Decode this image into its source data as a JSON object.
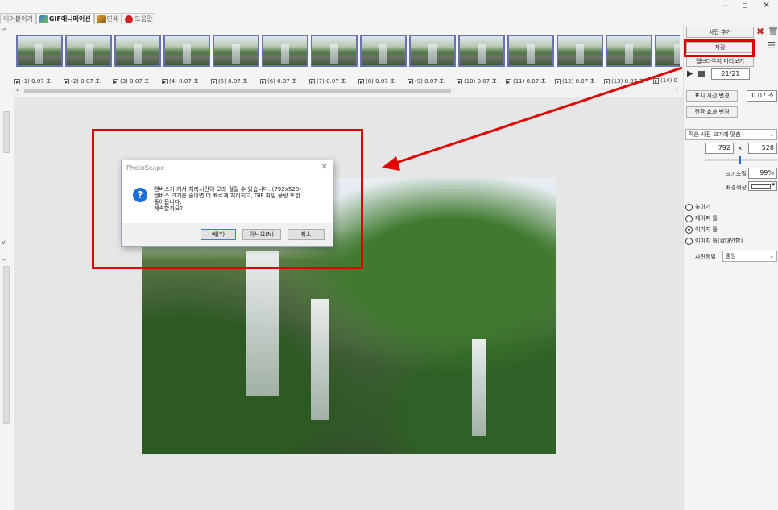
{
  "window": {
    "minimize_glyph": "–",
    "restore_glyph": "▫",
    "close_glyph": "✕"
  },
  "tabs": [
    {
      "label": "이어붙이기",
      "active": false
    },
    {
      "label": "GIF애니메이션",
      "active": true
    },
    {
      "label": "인쇄",
      "active": false
    },
    {
      "label": "도움말",
      "active": false
    }
  ],
  "frames": [
    "(1) 0.07 초",
    "(2) 0.07 초",
    "(3) 0.07 초",
    "(4) 0.07 초",
    "(5) 0.07 초",
    "(6) 0.07 초",
    "(7) 0.07 초",
    "(8) 0.07 초",
    "(9) 0.07 초",
    "(10) 0.07 초",
    "(11) 0.07 초",
    "(12) 0.07 초",
    "(13) 0.07 초",
    "(14) 0"
  ],
  "right_panel": {
    "add_photo": "사진 추가",
    "save": "저장",
    "preview": "웹브라우저 미리보기",
    "frame_counter": "21/21",
    "display_time_button": "표시 시간 변경",
    "display_time_value": "0.07 초",
    "transition_button": "전환 효과 변경",
    "size_mode": "작은 사진 크기에 맞춤",
    "width": "792",
    "x_sep": "x",
    "height": "528",
    "size_label": "크기조절",
    "size_value": "99%",
    "bgcolor_label": "배경색상",
    "radios": [
      {
        "label": "놓이기",
        "checked": false
      },
      {
        "label": "페이퍼 틀",
        "checked": false
      },
      {
        "label": "이미지 틀",
        "checked": true
      },
      {
        "label": "이미지 틀(확대안함)",
        "checked": false
      }
    ],
    "align_label": "사진정렬",
    "align_value": "중앙"
  },
  "dialog": {
    "title": "PhotoScape",
    "close": "✕",
    "icon": "?",
    "lines": [
      "캔버스가 커서 처리시간이 오래 걸릴 수 있습니다. (792x528)",
      "캔버스 크기를 줄이면 더 빠르게 처리되고, GIF 파일 용량 또한",
      "줄어듭니다.",
      "계속할까요?"
    ],
    "yes": "예(Y)",
    "no": "아니요(N)",
    "cancel": "취소"
  },
  "colors": {
    "annotation": "#e30000",
    "frame_border": "#6a72b0",
    "accent": "#1a6fd6"
  }
}
